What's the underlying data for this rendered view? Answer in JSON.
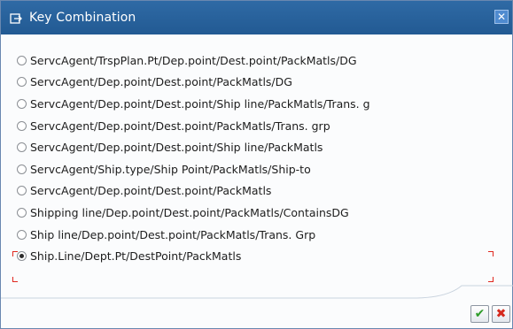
{
  "dialog": {
    "title": "Key Combination",
    "close_icon": "close-icon",
    "title_icon": "dialog-icon"
  },
  "options": [
    {
      "label": "ServcAgent/TrspPlan.Pt/Dep.point/Dest.point/PackMatls/DG",
      "selected": false
    },
    {
      "label": "ServcAgent/Dep.point/Dest.point/PackMatls/DG",
      "selected": false
    },
    {
      "label": "ServcAgent/Dep.point/Dest.point/Ship line/PackMatls/Trans. g",
      "selected": false
    },
    {
      "label": "ServcAgent/Dep.point/Dest.point/PackMatls/Trans. grp",
      "selected": false
    },
    {
      "label": "ServcAgent/Dep.point/Dest.point/Ship line/PackMatls",
      "selected": false
    },
    {
      "label": "ServcAgent/Ship.type/Ship Point/PackMatls/Ship-to",
      "selected": false
    },
    {
      "label": "ServcAgent/Dep.point/Dest.point/PackMatls",
      "selected": false
    },
    {
      "label": "Shipping line/Dep.point/Dest.point/PackMatls/ContainsDG",
      "selected": false
    },
    {
      "label": "Ship line/Dep.point/Dest.point/PackMatls/Trans. Grp",
      "selected": false
    },
    {
      "label": "Ship.Line/Dept.Pt/DestPoint/PackMatls",
      "selected": true
    }
  ],
  "footer": {
    "ok_icon": "checkmark-icon",
    "cancel_icon": "cancel-x-icon",
    "ok_color": "#2e9c2a",
    "cancel_color": "#d52a1e"
  }
}
